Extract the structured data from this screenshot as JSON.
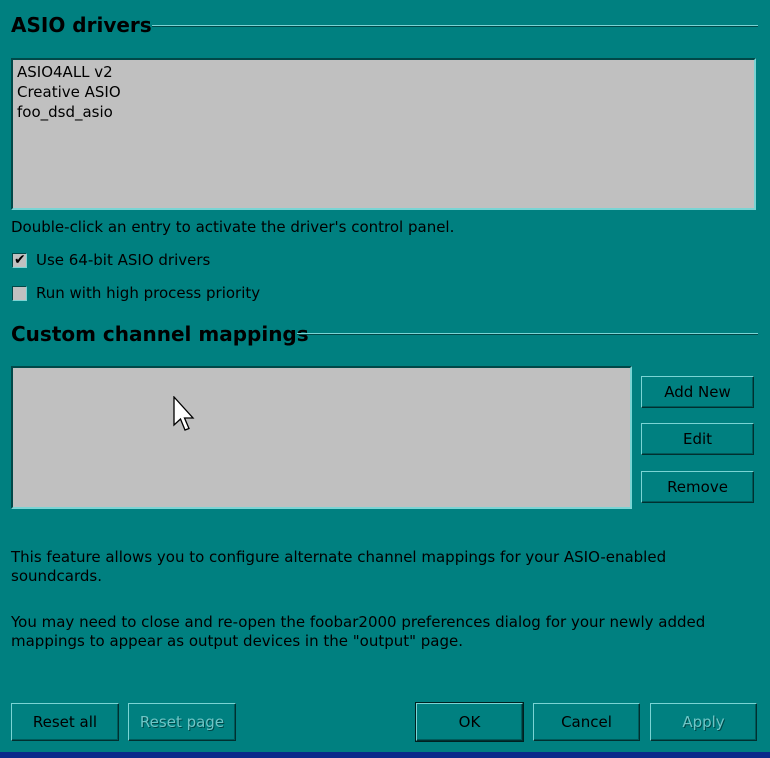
{
  "asio_section": {
    "title": "ASIO drivers",
    "drivers": [
      "ASIO4ALL v2",
      "Creative ASIO",
      "foo_dsd_asio"
    ],
    "hint": "Double-click an entry to activate the driver's control panel.",
    "use_64bit": {
      "label": "Use 64-bit ASIO drivers",
      "checked": true
    },
    "high_priority": {
      "label": "Run with high process priority",
      "checked": false
    }
  },
  "mapping_section": {
    "title": "Custom channel mappings",
    "add_new_label": "Add New",
    "edit_label": "Edit",
    "remove_label": "Remove",
    "info_line1": "This feature allows you to configure alternate channel mappings for your ASIO-enabled",
    "info_line2": "soundcards.",
    "info_line3": "You may need to close and re-open the foobar2000 preferences dialog for your newly added",
    "info_line4": "mappings to appear as output devices in the \"output\" page."
  },
  "footer": {
    "reset_all_label": "Reset all",
    "reset_page_label": "Reset page",
    "ok_label": "OK",
    "cancel_label": "Cancel",
    "apply_label": "Apply"
  },
  "colors": {
    "background": "#008080",
    "listbox": "#c0c0c0",
    "taskbar_strip": "#0a2a8a"
  }
}
